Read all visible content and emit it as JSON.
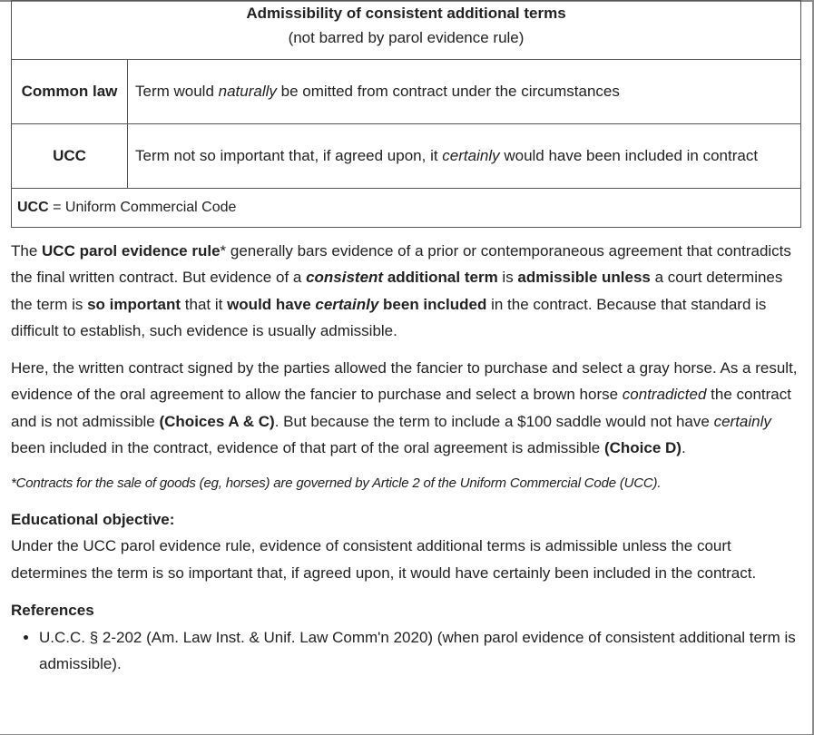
{
  "table": {
    "title": "Admissibility of consistent additional terms",
    "subtitle": "(not barred by parol evidence rule)",
    "rows": [
      {
        "label": "Common law",
        "t1": "Term would ",
        "t2": "naturally",
        "t3": " be omitted from contract under the circumstances"
      },
      {
        "label": "UCC",
        "t1": "Term not so important that, if agreed upon, it ",
        "t2": "certainly",
        "t3": " would have been included in contract"
      }
    ],
    "footnote_abbr": "UCC",
    "footnote_text": " = Uniform Commercial Code"
  },
  "para1": {
    "s1": "The ",
    "s2": "UCC parol evidence rule",
    "s3": "* generally bars evidence of a prior or contemporaneous agreement that contradicts the final written contract.  But evidence of a ",
    "s4": "consistent",
    "s5": " additional term",
    "s6": " is ",
    "s7": "admissible unless",
    "s8": " a court determines the term is ",
    "s9": "so important",
    "s10": " that it ",
    "s11": "would have ",
    "s12": "certainly",
    "s13": " been included",
    "s14": " in the contract.  Because that standard is difficult to establish, such evidence is usually admissible."
  },
  "para2": {
    "s1": "Here, the written contract signed by the parties allowed the fancier to purchase and select a gray horse.  As a result, evidence of the oral agreement to allow the fancier to purchase and select a brown horse ",
    "s2": "contradicted",
    "s3": " the contract and is not admissible ",
    "s4": "(Choices A & C)",
    "s5": ".  But because the term to include a $100 saddle would not have ",
    "s6": "certainly",
    "s7": " been included in the contract, evidence of that part of the oral agreement is admissible ",
    "s8": "(Choice D)",
    "s9": "."
  },
  "note": "*Contracts for the sale of goods (eg, horses) are governed by Article 2 of the Uniform Commercial Code (UCC).",
  "objective": {
    "heading": "Educational objective:",
    "text": "Under the UCC parol evidence rule, evidence of consistent additional terms is admissible unless the court determines the term is so important that, if agreed upon, it would have certainly been included in the contract."
  },
  "references": {
    "heading": "References",
    "items": [
      {
        "text": "U.C.C. § 2-202 (Am. Law Inst. & Unif. Law Comm'n 2020) (when parol evidence of consistent additional term is admissible)."
      }
    ]
  }
}
